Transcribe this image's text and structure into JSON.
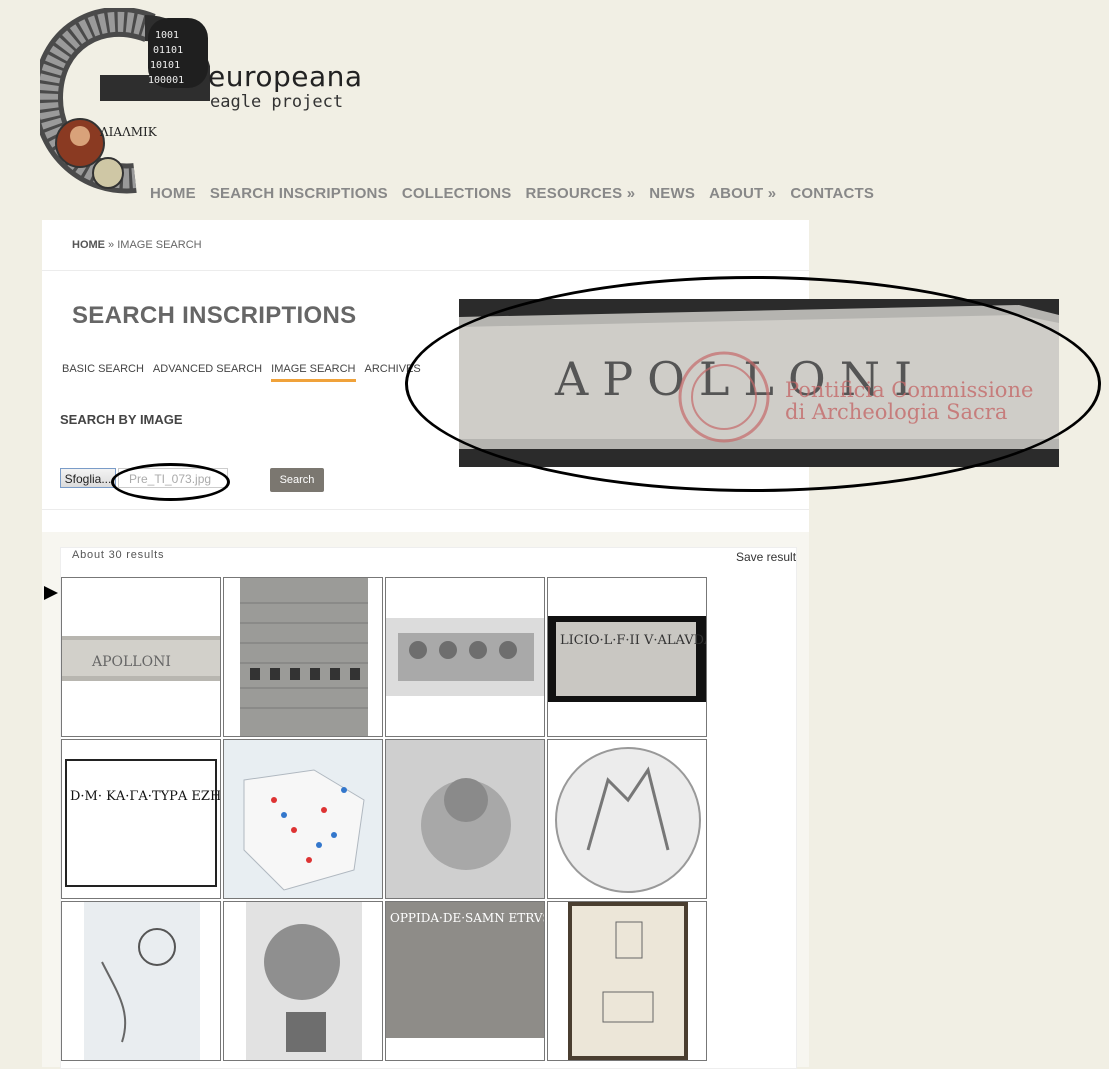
{
  "brand": {
    "name": "europeana",
    "sub": "eagle project"
  },
  "nav": [
    "HOME",
    "SEARCH INSCRIPTIONS",
    "COLLECTIONS",
    "RESOURCES »",
    "NEWS",
    "ABOUT »",
    "CONTACTS"
  ],
  "breadcrumb": {
    "home": "HOME",
    "sep": " » ",
    "current": "IMAGE SEARCH"
  },
  "page_title": "SEARCH INSCRIPTIONS",
  "tabs": [
    "BASIC SEARCH",
    "ADVANCED SEARCH",
    "IMAGE SEARCH",
    "ARCHIVES"
  ],
  "section_title": "SEARCH BY IMAGE",
  "upload": {
    "browse_label": "Sfoglia...",
    "file_name": "Pre_TI_073.jpg",
    "search_label": "Search"
  },
  "results": {
    "count_text": "About 30 results",
    "save_label": "Save result"
  },
  "preview": {
    "inscription": "APOLLONI",
    "watermark_line1": "Pontificia Commissione",
    "watermark_line2": "di Archeologia Sacra"
  },
  "thumbs": [
    {
      "text": "APOLLONI"
    },
    {
      "text": ""
    },
    {
      "text": ""
    },
    {
      "text": "LICIO·L·F·II V·ALAVDAE·X"
    },
    {
      "text": "D·M· ΚΑ·ΓΑ·ΤΥΡΑ ΕΖΗΓΕΝΕΗ ΝΕ·Μ·Ε·ΗΜΙΖ"
    },
    {
      "text": ""
    },
    {
      "text": ""
    },
    {
      "text": ""
    },
    {
      "text": ""
    },
    {
      "text": ""
    },
    {
      "text": "OPPIDA·DE·SAMN ETRVSCORVM·EXERC CVM·PYRRHO·REG VIAM·APPIAM·STRAV DVXIT·AEDEM·BELL"
    },
    {
      "text": ""
    }
  ]
}
